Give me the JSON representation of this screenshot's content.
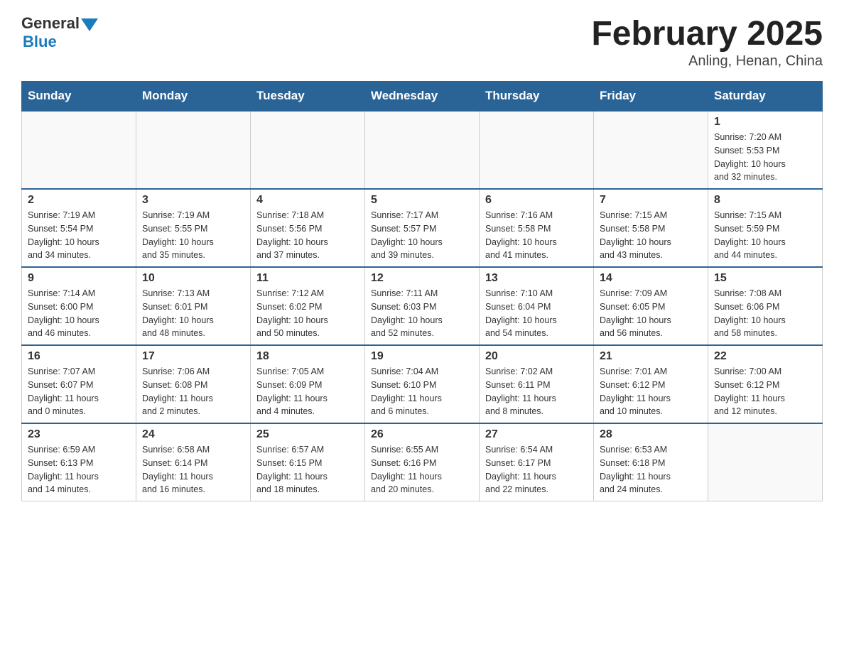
{
  "header": {
    "logo_general": "General",
    "logo_blue": "Blue",
    "month_title": "February 2025",
    "location": "Anling, Henan, China"
  },
  "weekdays": [
    "Sunday",
    "Monday",
    "Tuesday",
    "Wednesday",
    "Thursday",
    "Friday",
    "Saturday"
  ],
  "weeks": [
    [
      {
        "day": "",
        "info": ""
      },
      {
        "day": "",
        "info": ""
      },
      {
        "day": "",
        "info": ""
      },
      {
        "day": "",
        "info": ""
      },
      {
        "day": "",
        "info": ""
      },
      {
        "day": "",
        "info": ""
      },
      {
        "day": "1",
        "info": "Sunrise: 7:20 AM\nSunset: 5:53 PM\nDaylight: 10 hours\nand 32 minutes."
      }
    ],
    [
      {
        "day": "2",
        "info": "Sunrise: 7:19 AM\nSunset: 5:54 PM\nDaylight: 10 hours\nand 34 minutes."
      },
      {
        "day": "3",
        "info": "Sunrise: 7:19 AM\nSunset: 5:55 PM\nDaylight: 10 hours\nand 35 minutes."
      },
      {
        "day": "4",
        "info": "Sunrise: 7:18 AM\nSunset: 5:56 PM\nDaylight: 10 hours\nand 37 minutes."
      },
      {
        "day": "5",
        "info": "Sunrise: 7:17 AM\nSunset: 5:57 PM\nDaylight: 10 hours\nand 39 minutes."
      },
      {
        "day": "6",
        "info": "Sunrise: 7:16 AM\nSunset: 5:58 PM\nDaylight: 10 hours\nand 41 minutes."
      },
      {
        "day": "7",
        "info": "Sunrise: 7:15 AM\nSunset: 5:58 PM\nDaylight: 10 hours\nand 43 minutes."
      },
      {
        "day": "8",
        "info": "Sunrise: 7:15 AM\nSunset: 5:59 PM\nDaylight: 10 hours\nand 44 minutes."
      }
    ],
    [
      {
        "day": "9",
        "info": "Sunrise: 7:14 AM\nSunset: 6:00 PM\nDaylight: 10 hours\nand 46 minutes."
      },
      {
        "day": "10",
        "info": "Sunrise: 7:13 AM\nSunset: 6:01 PM\nDaylight: 10 hours\nand 48 minutes."
      },
      {
        "day": "11",
        "info": "Sunrise: 7:12 AM\nSunset: 6:02 PM\nDaylight: 10 hours\nand 50 minutes."
      },
      {
        "day": "12",
        "info": "Sunrise: 7:11 AM\nSunset: 6:03 PM\nDaylight: 10 hours\nand 52 minutes."
      },
      {
        "day": "13",
        "info": "Sunrise: 7:10 AM\nSunset: 6:04 PM\nDaylight: 10 hours\nand 54 minutes."
      },
      {
        "day": "14",
        "info": "Sunrise: 7:09 AM\nSunset: 6:05 PM\nDaylight: 10 hours\nand 56 minutes."
      },
      {
        "day": "15",
        "info": "Sunrise: 7:08 AM\nSunset: 6:06 PM\nDaylight: 10 hours\nand 58 minutes."
      }
    ],
    [
      {
        "day": "16",
        "info": "Sunrise: 7:07 AM\nSunset: 6:07 PM\nDaylight: 11 hours\nand 0 minutes."
      },
      {
        "day": "17",
        "info": "Sunrise: 7:06 AM\nSunset: 6:08 PM\nDaylight: 11 hours\nand 2 minutes."
      },
      {
        "day": "18",
        "info": "Sunrise: 7:05 AM\nSunset: 6:09 PM\nDaylight: 11 hours\nand 4 minutes."
      },
      {
        "day": "19",
        "info": "Sunrise: 7:04 AM\nSunset: 6:10 PM\nDaylight: 11 hours\nand 6 minutes."
      },
      {
        "day": "20",
        "info": "Sunrise: 7:02 AM\nSunset: 6:11 PM\nDaylight: 11 hours\nand 8 minutes."
      },
      {
        "day": "21",
        "info": "Sunrise: 7:01 AM\nSunset: 6:12 PM\nDaylight: 11 hours\nand 10 minutes."
      },
      {
        "day": "22",
        "info": "Sunrise: 7:00 AM\nSunset: 6:12 PM\nDaylight: 11 hours\nand 12 minutes."
      }
    ],
    [
      {
        "day": "23",
        "info": "Sunrise: 6:59 AM\nSunset: 6:13 PM\nDaylight: 11 hours\nand 14 minutes."
      },
      {
        "day": "24",
        "info": "Sunrise: 6:58 AM\nSunset: 6:14 PM\nDaylight: 11 hours\nand 16 minutes."
      },
      {
        "day": "25",
        "info": "Sunrise: 6:57 AM\nSunset: 6:15 PM\nDaylight: 11 hours\nand 18 minutes."
      },
      {
        "day": "26",
        "info": "Sunrise: 6:55 AM\nSunset: 6:16 PM\nDaylight: 11 hours\nand 20 minutes."
      },
      {
        "day": "27",
        "info": "Sunrise: 6:54 AM\nSunset: 6:17 PM\nDaylight: 11 hours\nand 22 minutes."
      },
      {
        "day": "28",
        "info": "Sunrise: 6:53 AM\nSunset: 6:18 PM\nDaylight: 11 hours\nand 24 minutes."
      },
      {
        "day": "",
        "info": ""
      }
    ]
  ]
}
